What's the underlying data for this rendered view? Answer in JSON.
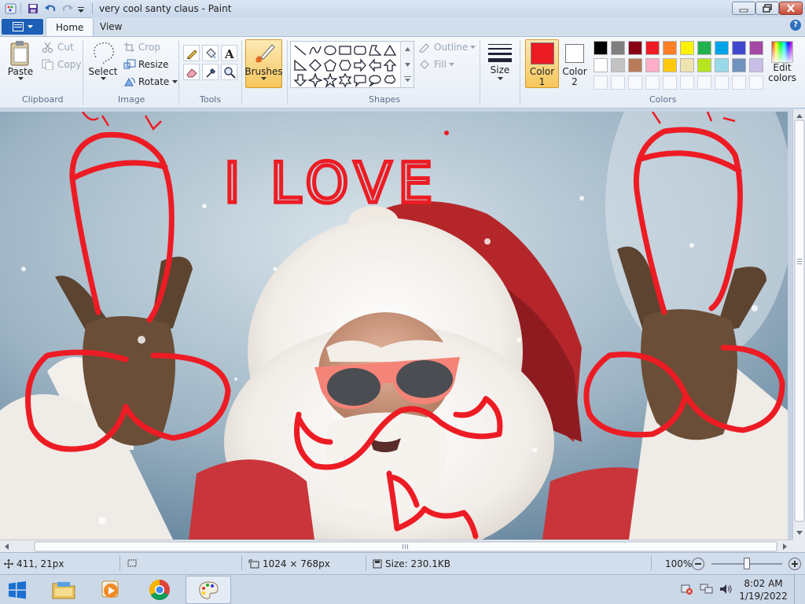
{
  "app": {
    "title": "very cool santy claus - Paint"
  },
  "tabs": {
    "file": "",
    "home": "Home",
    "view": "View"
  },
  "clipboard": {
    "paste": "Paste",
    "cut": "Cut",
    "copy": "Copy",
    "group": "Clipboard"
  },
  "image": {
    "select": "Select",
    "crop": "Crop",
    "resize": "Resize",
    "rotate": "Rotate",
    "group": "Image"
  },
  "tools": {
    "group": "Tools",
    "brushes": "Brushes"
  },
  "shapes": {
    "outline": "Outline",
    "fill": "Fill",
    "group": "Shapes"
  },
  "size": {
    "label": "Size"
  },
  "colors": {
    "color1_line1": "Color",
    "color1_line2": "1",
    "color2_line1": "Color",
    "color2_line2": "2",
    "group": "Colors",
    "edit_line1": "Edit",
    "edit_line2": "colors",
    "color1_value": "#ed1c24",
    "color2_value": "#ffffff",
    "palette_row1": [
      "#000000",
      "#7f7f7f",
      "#880015",
      "#ed1c24",
      "#ff7f27",
      "#fff200",
      "#22b14c",
      "#00a2e8",
      "#3f48cc",
      "#a349a4"
    ],
    "palette_row2": [
      "#ffffff",
      "#c3c3c3",
      "#b97a57",
      "#ffaec9",
      "#ffc90e",
      "#efe4b0",
      "#b5e61d",
      "#99d9ea",
      "#7092be",
      "#c8bfe7"
    ]
  },
  "drawing": {
    "text": "I LOVE"
  },
  "status": {
    "cursor": "411, 21px",
    "dimensions": "1024 × 768px",
    "size": "Size: 230.1KB",
    "zoom": "100%"
  },
  "taskbar": {
    "time": "8:02 AM",
    "date": "1/19/2022"
  }
}
